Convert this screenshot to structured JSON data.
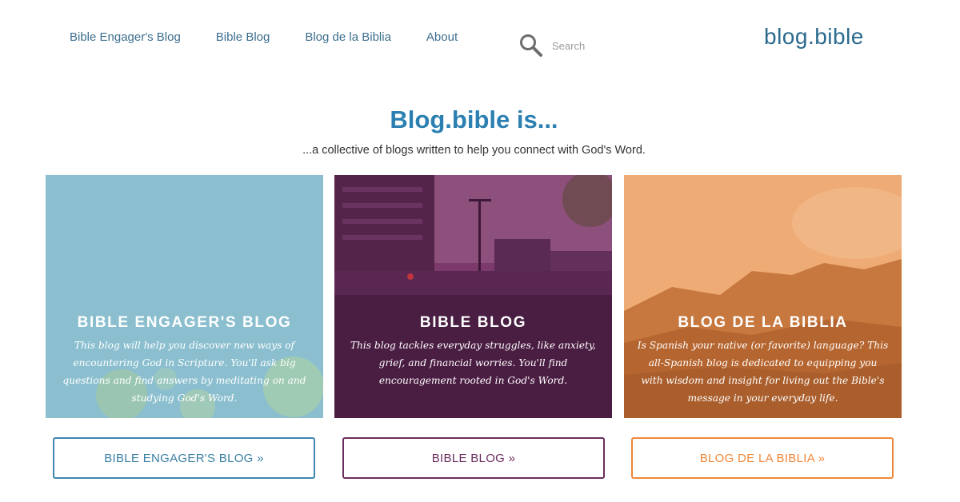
{
  "header": {
    "nav": [
      {
        "label": "Bible Engager's Blog"
      },
      {
        "label": "Bible Blog"
      },
      {
        "label": "Blog de la Biblia"
      },
      {
        "label": "About"
      }
    ],
    "search": {
      "placeholder": "Search",
      "icon": "search-icon"
    },
    "logo": "blog.bible"
  },
  "hero": {
    "title": "Blog.bible is...",
    "subtitle": "...a collective of blogs written to help you connect with God's Word."
  },
  "cards": [
    {
      "title": "BIBLE ENGAGER'S BLOG",
      "description": "This blog will help you discover new ways of encountering God in Scripture. You'll ask big questions and find answers by meditating on and studying God's Word.",
      "button": "BIBLE ENGAGER'S BLOG »",
      "color": "#8bbfcf",
      "accent": "#3b89ae"
    },
    {
      "title": "BIBLE BLOG",
      "description": "This blog tackles everyday struggles, like anxiety, grief, and financial worries. You'll find encouragement rooted in God's Word.",
      "button": "BIBLE BLOG »",
      "color": "#6b2d5e",
      "accent": "#6b2d5e"
    },
    {
      "title": "BLOG DE LA BIBLIA",
      "description": "Is Spanish your native (or favorite) language? This all-Spanish blog is dedicated to equipping you with wisdom and insight for living out the Bible's message in your everyday life.",
      "button": "BLOG DE LA BIBLIA »",
      "color": "#d88a4a",
      "accent": "#f0883a"
    }
  ]
}
